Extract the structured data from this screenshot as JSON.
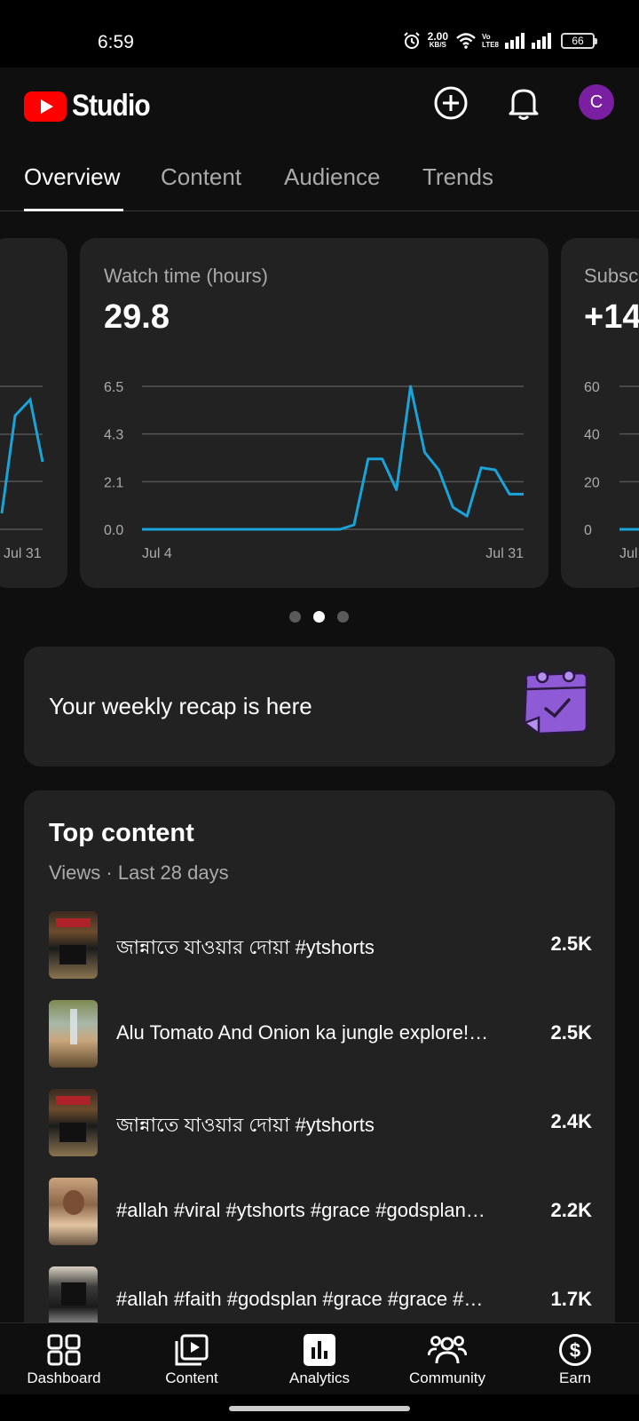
{
  "status_bar": {
    "time": "6:59",
    "net_speed_value": "2.00",
    "net_speed_unit": "KB/S",
    "volte_top": "Vo",
    "volte_bottom": "LTE8",
    "battery": "66",
    "icons": [
      "alarm-icon",
      "wifi-icon",
      "signal-icon",
      "signal-icon",
      "battery-icon"
    ]
  },
  "header": {
    "app_name": "Studio",
    "avatar_letter": "C",
    "icons": [
      "youtube-logo-icon",
      "create-icon",
      "bell-icon"
    ]
  },
  "tabs": [
    {
      "label": "Overview",
      "active": true
    },
    {
      "label": "Content",
      "active": false
    },
    {
      "label": "Audience",
      "active": false
    },
    {
      "label": "Trends",
      "active": false
    }
  ],
  "cards": {
    "left": {
      "x_end_label": "Jul 31"
    },
    "main": {
      "label": "Watch time (hours)",
      "value": "29.8"
    },
    "right": {
      "label": "Subscribers",
      "value": "+14",
      "x_start_label": "Jul"
    }
  },
  "chart_data": [
    {
      "type": "line",
      "title": "Watch time (hours)",
      "ylim": [
        0,
        6.5
      ],
      "y_ticks": [
        "6.5",
        "4.3",
        "2.1",
        "0.0"
      ],
      "x_tick_labels": [
        "Jul 4",
        "Jul 31"
      ],
      "x": [
        "Jul 4",
        "Jul 5",
        "Jul 6",
        "Jul 7",
        "Jul 8",
        "Jul 9",
        "Jul 10",
        "Jul 11",
        "Jul 12",
        "Jul 13",
        "Jul 14",
        "Jul 15",
        "Jul 16",
        "Jul 17",
        "Jul 18",
        "Jul 19",
        "Jul 20",
        "Jul 21",
        "Jul 22",
        "Jul 23",
        "Jul 24",
        "Jul 25",
        "Jul 26",
        "Jul 27",
        "Jul 28",
        "Jul 29",
        "Jul 30",
        "Jul 31"
      ],
      "values": [
        0,
        0,
        0,
        0,
        0,
        0,
        0,
        0,
        0,
        0,
        0,
        0,
        0,
        0,
        0,
        0.2,
        3.2,
        3.2,
        1.8,
        6.5,
        3.5,
        2.7,
        1.0,
        0.6,
        2.8,
        2.7,
        1.6,
        1.6
      ],
      "color": "#1aa3d9",
      "grid": true
    },
    {
      "type": "line",
      "title": "Subscribers",
      "ylim": [
        0,
        60
      ],
      "y_ticks": [
        "60",
        "40",
        "20",
        "0"
      ],
      "x_tick_labels": [
        "Jul"
      ],
      "color": "#1aa3d9",
      "grid": true
    }
  ],
  "carousel": {
    "count": 3,
    "active_index": 1
  },
  "recap": {
    "text": "Your weekly recap is here",
    "icon": "calendar-check-icon"
  },
  "top_content": {
    "title": "Top content",
    "subtitle": "Views · Last 28 days",
    "items": [
      {
        "title": "জান্নাতে যাওয়ার দোয়া #ytshorts",
        "views": "2.5K"
      },
      {
        "title": "Alu Tomato And Onion ka jungle explore!…",
        "views": "2.5K"
      },
      {
        "title": "জান্নাতে যাওয়ার দোয়া #ytshorts",
        "views": "2.4K"
      },
      {
        "title": "#allah #viral #ytshorts #grace #godsplan…",
        "views": "2.2K"
      },
      {
        "title": "#allah #faith #godsplan #grace #grace #…",
        "views": "1.7K"
      }
    ]
  },
  "bottom_nav": [
    {
      "label": "Dashboard",
      "icon": "dashboard-icon"
    },
    {
      "label": "Content",
      "icon": "content-icon"
    },
    {
      "label": "Analytics",
      "icon": "analytics-icon",
      "active": true
    },
    {
      "label": "Community",
      "icon": "community-icon"
    },
    {
      "label": "Earn",
      "icon": "earn-icon"
    }
  ]
}
